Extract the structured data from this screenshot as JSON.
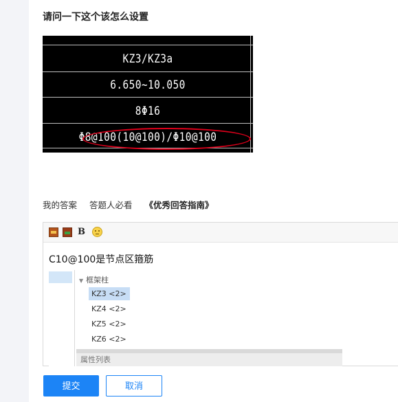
{
  "question": {
    "title": "请问一下这个该怎么设置"
  },
  "cad_image": {
    "rows": [
      "KZ3/KZ3a",
      "6.650~10.050",
      "8Φ16",
      "Φ8@100(10@100)/Φ10@100"
    ],
    "highlight_color": "#e0001b"
  },
  "answer_tabs": {
    "my_answer": "我的答案",
    "must_read": "答题人必看",
    "guide": "《优秀回答指南》"
  },
  "editor": {
    "toolbar": {
      "image_icon": "image-icon",
      "screenshot_icon": "screenshot-icon",
      "bold_label": "B",
      "emoji_icon": "emoji-icon"
    },
    "content_text": "C10@100是节点区箍筋",
    "embedded_screenshot": {
      "tree_header": "框架柱",
      "items": [
        "KZ3 <2>",
        "KZ4 <2>",
        "KZ5 <2>",
        "KZ6 <2>"
      ],
      "selected_index": 0,
      "panel_title": "属性列表"
    }
  },
  "buttons": {
    "submit": "提交",
    "cancel": "取消"
  },
  "colors": {
    "primary": "#1c84f6",
    "selection": "#c7ddf5"
  }
}
